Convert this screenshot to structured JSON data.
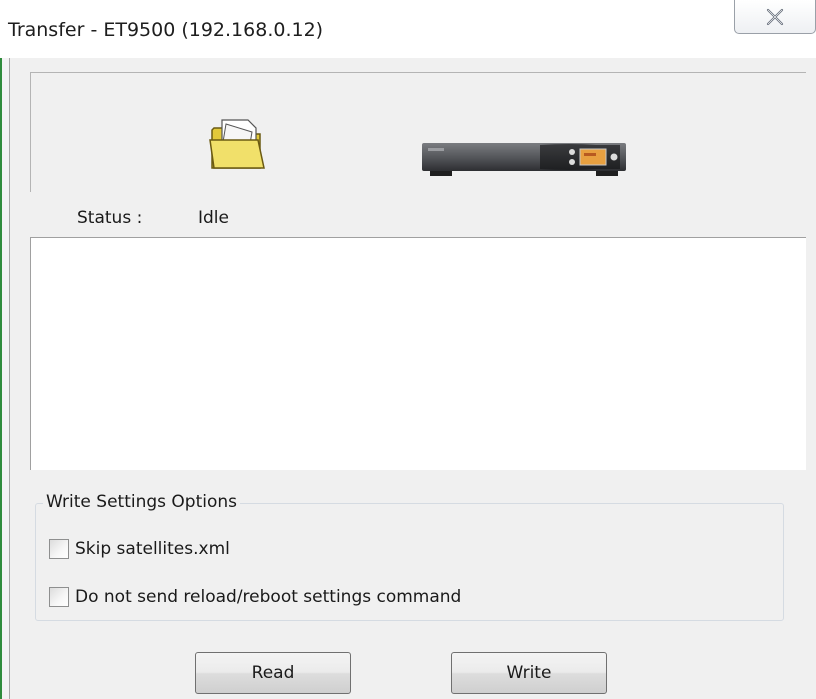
{
  "window": {
    "title": "Transfer - ET9500 (192.168.0.12)",
    "accent_color": "#2f8c3c"
  },
  "titlebar": {
    "close_icon": "close-x-icon"
  },
  "icons": {
    "folder": "folder-icon",
    "receiver": "satellite-receiver-icon"
  },
  "status": {
    "label": "Status :",
    "value": "Idle"
  },
  "log": {
    "text": ""
  },
  "write_options": {
    "legend": "Write Settings Options",
    "items": [
      {
        "label": "Skip satellites.xml",
        "checked": false
      },
      {
        "label": "Do not send reload/reboot settings command",
        "checked": false
      }
    ]
  },
  "buttons": {
    "read_label": "Read",
    "write_label": "Write"
  }
}
